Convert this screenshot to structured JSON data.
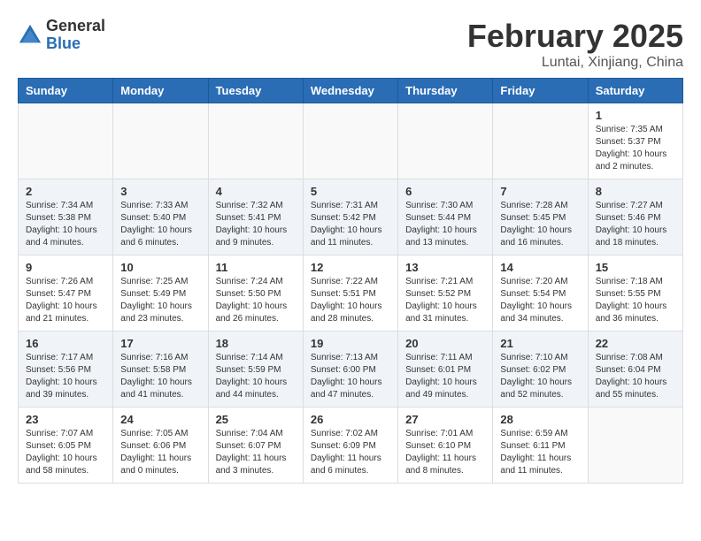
{
  "header": {
    "logo_general": "General",
    "logo_blue": "Blue",
    "month_title": "February 2025",
    "location": "Luntai, Xinjiang, China"
  },
  "days_of_week": [
    "Sunday",
    "Monday",
    "Tuesday",
    "Wednesday",
    "Thursday",
    "Friday",
    "Saturday"
  ],
  "weeks": [
    [
      {
        "day": "",
        "info": ""
      },
      {
        "day": "",
        "info": ""
      },
      {
        "day": "",
        "info": ""
      },
      {
        "day": "",
        "info": ""
      },
      {
        "day": "",
        "info": ""
      },
      {
        "day": "",
        "info": ""
      },
      {
        "day": "1",
        "info": "Sunrise: 7:35 AM\nSunset: 5:37 PM\nDaylight: 10 hours\nand 2 minutes."
      }
    ],
    [
      {
        "day": "2",
        "info": "Sunrise: 7:34 AM\nSunset: 5:38 PM\nDaylight: 10 hours\nand 4 minutes."
      },
      {
        "day": "3",
        "info": "Sunrise: 7:33 AM\nSunset: 5:40 PM\nDaylight: 10 hours\nand 6 minutes."
      },
      {
        "day": "4",
        "info": "Sunrise: 7:32 AM\nSunset: 5:41 PM\nDaylight: 10 hours\nand 9 minutes."
      },
      {
        "day": "5",
        "info": "Sunrise: 7:31 AM\nSunset: 5:42 PM\nDaylight: 10 hours\nand 11 minutes."
      },
      {
        "day": "6",
        "info": "Sunrise: 7:30 AM\nSunset: 5:44 PM\nDaylight: 10 hours\nand 13 minutes."
      },
      {
        "day": "7",
        "info": "Sunrise: 7:28 AM\nSunset: 5:45 PM\nDaylight: 10 hours\nand 16 minutes."
      },
      {
        "day": "8",
        "info": "Sunrise: 7:27 AM\nSunset: 5:46 PM\nDaylight: 10 hours\nand 18 minutes."
      }
    ],
    [
      {
        "day": "9",
        "info": "Sunrise: 7:26 AM\nSunset: 5:47 PM\nDaylight: 10 hours\nand 21 minutes."
      },
      {
        "day": "10",
        "info": "Sunrise: 7:25 AM\nSunset: 5:49 PM\nDaylight: 10 hours\nand 23 minutes."
      },
      {
        "day": "11",
        "info": "Sunrise: 7:24 AM\nSunset: 5:50 PM\nDaylight: 10 hours\nand 26 minutes."
      },
      {
        "day": "12",
        "info": "Sunrise: 7:22 AM\nSunset: 5:51 PM\nDaylight: 10 hours\nand 28 minutes."
      },
      {
        "day": "13",
        "info": "Sunrise: 7:21 AM\nSunset: 5:52 PM\nDaylight: 10 hours\nand 31 minutes."
      },
      {
        "day": "14",
        "info": "Sunrise: 7:20 AM\nSunset: 5:54 PM\nDaylight: 10 hours\nand 34 minutes."
      },
      {
        "day": "15",
        "info": "Sunrise: 7:18 AM\nSunset: 5:55 PM\nDaylight: 10 hours\nand 36 minutes."
      }
    ],
    [
      {
        "day": "16",
        "info": "Sunrise: 7:17 AM\nSunset: 5:56 PM\nDaylight: 10 hours\nand 39 minutes."
      },
      {
        "day": "17",
        "info": "Sunrise: 7:16 AM\nSunset: 5:58 PM\nDaylight: 10 hours\nand 41 minutes."
      },
      {
        "day": "18",
        "info": "Sunrise: 7:14 AM\nSunset: 5:59 PM\nDaylight: 10 hours\nand 44 minutes."
      },
      {
        "day": "19",
        "info": "Sunrise: 7:13 AM\nSunset: 6:00 PM\nDaylight: 10 hours\nand 47 minutes."
      },
      {
        "day": "20",
        "info": "Sunrise: 7:11 AM\nSunset: 6:01 PM\nDaylight: 10 hours\nand 49 minutes."
      },
      {
        "day": "21",
        "info": "Sunrise: 7:10 AM\nSunset: 6:02 PM\nDaylight: 10 hours\nand 52 minutes."
      },
      {
        "day": "22",
        "info": "Sunrise: 7:08 AM\nSunset: 6:04 PM\nDaylight: 10 hours\nand 55 minutes."
      }
    ],
    [
      {
        "day": "23",
        "info": "Sunrise: 7:07 AM\nSunset: 6:05 PM\nDaylight: 10 hours\nand 58 minutes."
      },
      {
        "day": "24",
        "info": "Sunrise: 7:05 AM\nSunset: 6:06 PM\nDaylight: 11 hours\nand 0 minutes."
      },
      {
        "day": "25",
        "info": "Sunrise: 7:04 AM\nSunset: 6:07 PM\nDaylight: 11 hours\nand 3 minutes."
      },
      {
        "day": "26",
        "info": "Sunrise: 7:02 AM\nSunset: 6:09 PM\nDaylight: 11 hours\nand 6 minutes."
      },
      {
        "day": "27",
        "info": "Sunrise: 7:01 AM\nSunset: 6:10 PM\nDaylight: 11 hours\nand 8 minutes."
      },
      {
        "day": "28",
        "info": "Sunrise: 6:59 AM\nSunset: 6:11 PM\nDaylight: 11 hours\nand 11 minutes."
      },
      {
        "day": "",
        "info": ""
      }
    ]
  ]
}
